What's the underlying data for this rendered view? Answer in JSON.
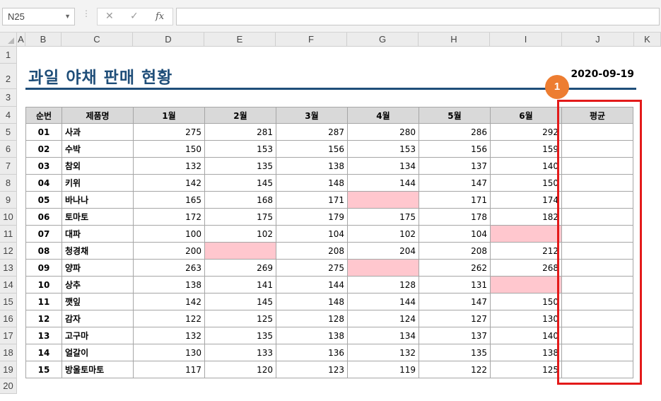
{
  "formula_bar": {
    "name_box": "N25",
    "formula": ""
  },
  "columns": [
    "A",
    "B",
    "C",
    "D",
    "E",
    "F",
    "G",
    "H",
    "I",
    "J",
    "K"
  ],
  "rows": [
    "1",
    "2",
    "3",
    "4",
    "5",
    "6",
    "7",
    "8",
    "9",
    "10",
    "11",
    "12",
    "13",
    "14",
    "15",
    "16",
    "17",
    "18",
    "19",
    "20"
  ],
  "sheet": {
    "title": "과일 야채 판매 현황",
    "date": "2020-09-19",
    "badge": "1"
  },
  "table": {
    "headers": [
      "순번",
      "제품명",
      "1월",
      "2월",
      "3월",
      "4월",
      "5월",
      "6월",
      "평균"
    ],
    "rows": [
      [
        "01",
        "사과",
        "275",
        "281",
        "287",
        "280",
        "286",
        "292",
        ""
      ],
      [
        "02",
        "수박",
        "150",
        "153",
        "156",
        "153",
        "156",
        "159",
        ""
      ],
      [
        "03",
        "참외",
        "132",
        "135",
        "138",
        "134",
        "137",
        "140",
        ""
      ],
      [
        "04",
        "키위",
        "142",
        "145",
        "148",
        "144",
        "147",
        "150",
        ""
      ],
      [
        "05",
        "바나나",
        "165",
        "168",
        "171",
        "",
        "171",
        "174",
        ""
      ],
      [
        "06",
        "토마토",
        "172",
        "175",
        "179",
        "175",
        "178",
        "182",
        ""
      ],
      [
        "07",
        "대파",
        "100",
        "102",
        "104",
        "102",
        "104",
        "",
        ""
      ],
      [
        "08",
        "청경채",
        "200",
        "",
        "208",
        "204",
        "208",
        "212",
        ""
      ],
      [
        "09",
        "양파",
        "263",
        "269",
        "275",
        "",
        "262",
        "268",
        ""
      ],
      [
        "10",
        "상추",
        "138",
        "141",
        "144",
        "128",
        "131",
        "",
        ""
      ],
      [
        "11",
        "깻잎",
        "142",
        "145",
        "148",
        "144",
        "147",
        "150",
        ""
      ],
      [
        "12",
        "감자",
        "122",
        "125",
        "128",
        "124",
        "127",
        "130",
        ""
      ],
      [
        "13",
        "고구마",
        "132",
        "135",
        "138",
        "134",
        "137",
        "140",
        ""
      ],
      [
        "14",
        "얼갈이",
        "130",
        "133",
        "136",
        "132",
        "135",
        "138",
        ""
      ],
      [
        "15",
        "방울토마토",
        "117",
        "120",
        "123",
        "119",
        "122",
        "125",
        ""
      ]
    ]
  },
  "colors": {
    "title": "#1f4e79",
    "blank_cell": "#ffc7ce",
    "badge": "#ed7d31",
    "highlight": "#e31a1a",
    "header_fill": "#d9d9d9"
  },
  "icons": {
    "name_box_dropdown": "chevron-down-icon",
    "cancel": "cancel-x-icon",
    "enter": "check-icon",
    "insert_function": "fx-icon"
  }
}
